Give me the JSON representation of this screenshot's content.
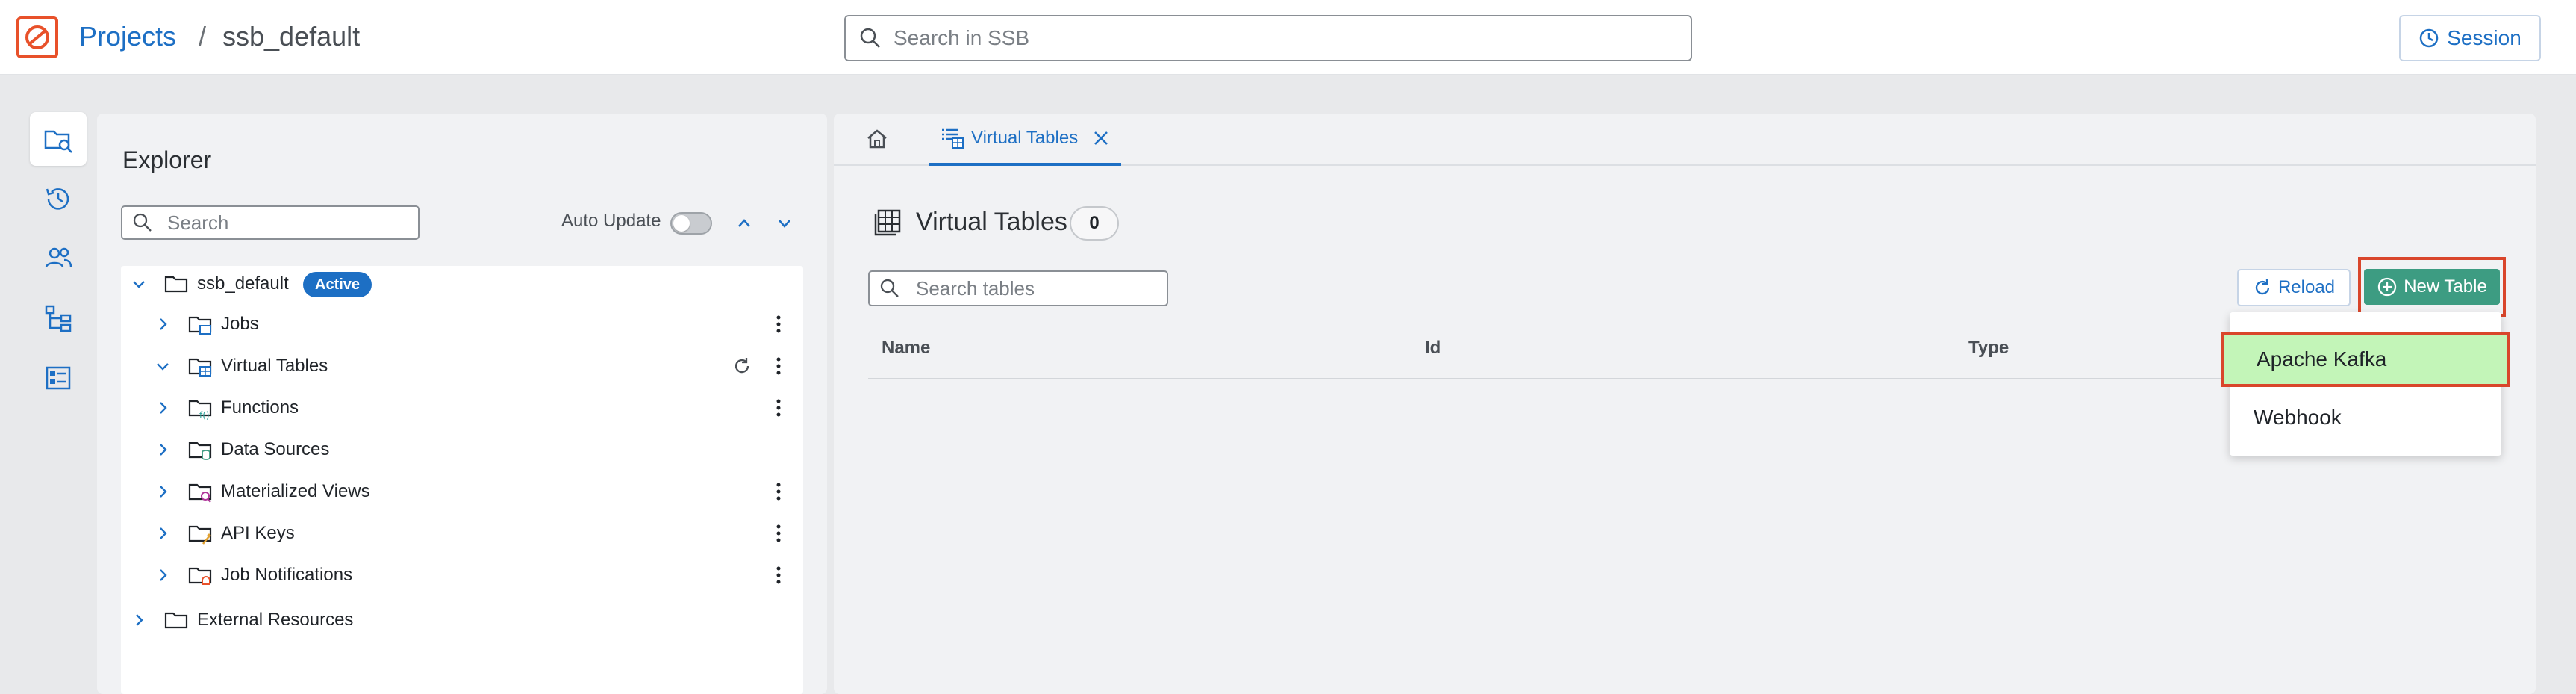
{
  "header": {
    "breadcrumb_projects": "Projects",
    "breadcrumb_sep": "/",
    "breadcrumb_current": "ssb_default",
    "search_placeholder": "Search in SSB",
    "session_label": "Session",
    "brand_color": "#e8512a",
    "accent_color": "#1d6fc4"
  },
  "rail": {
    "items": [
      "explorer-icon",
      "history-icon",
      "users-icon",
      "tree-icon",
      "dashboard-icon"
    ]
  },
  "explorer": {
    "title": "Explorer",
    "search_placeholder": "Search",
    "auto_update_label": "Auto Update",
    "auto_update_on": false,
    "root": {
      "label": "ssb_default",
      "badge": "Active"
    },
    "items": [
      {
        "label": "Jobs",
        "menu": true
      },
      {
        "label": "Virtual Tables",
        "menu": true,
        "refresh": true,
        "expanded": true
      },
      {
        "label": "Functions",
        "menu": true
      },
      {
        "label": "Data Sources",
        "menu": false
      },
      {
        "label": "Materialized Views",
        "menu": true
      },
      {
        "label": "API Keys",
        "menu": true
      },
      {
        "label": "Job Notifications",
        "menu": true
      }
    ],
    "external": "External Resources"
  },
  "main": {
    "tab_label": "Virtual Tables",
    "heading": "Virtual Tables",
    "count": "0",
    "search_placeholder": "Search tables",
    "reload_label": "Reload",
    "new_table_label": "New Table",
    "columns": [
      "Name",
      "Id",
      "Type"
    ],
    "dropdown": [
      "Apache Kafka",
      "Webhook"
    ]
  }
}
